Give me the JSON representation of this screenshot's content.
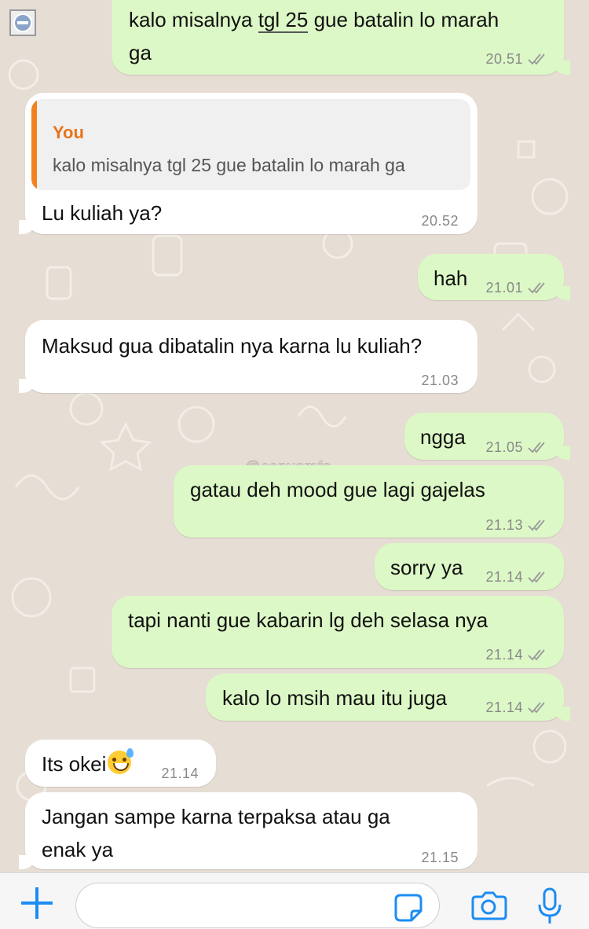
{
  "app": "WhatsApp",
  "colors": {
    "outgoing_bubble": "#dcf8c6",
    "incoming_bubble": "#ffffff",
    "quote_accent": "#f2821f",
    "icon_blue": "#1d8cf3"
  },
  "messages": [
    {
      "dir": "out",
      "lines": [
        "kalo misalnya tgl 25 gue batalin lo marah",
        "ga"
      ],
      "time": "20.51",
      "read_ticks": "double-check-icon"
    },
    {
      "dir": "in",
      "quote": {
        "author": "You",
        "text": "kalo misalnya tgl 25 gue batalin lo marah ga"
      },
      "text": "Lu kuliah ya?",
      "time": "20.52"
    },
    {
      "dir": "out",
      "text": "hah",
      "time": "21.01",
      "read_ticks": "double-check-icon"
    },
    {
      "dir": "in",
      "text": "Maksud gua dibatalin nya karna lu kuliah?",
      "time": "21.03"
    },
    {
      "dir": "out",
      "text": "ngga",
      "time": "21.05",
      "read_ticks": "double-check-icon"
    },
    {
      "dir": "out",
      "text": "gatau deh mood gue lagi gajelas",
      "time": "21.13",
      "read_ticks": "double-check-icon"
    },
    {
      "dir": "out",
      "text": "sorry ya",
      "time": "21.14",
      "read_ticks": "double-check-icon"
    },
    {
      "dir": "out",
      "text": "tapi nanti gue kabarin lg deh selasa nya",
      "time": "21.14",
      "read_ticks": "double-check-icon"
    },
    {
      "dir": "out",
      "text": "kalo lo msih mau itu juga",
      "time": "21.14",
      "read_ticks": "double-check-icon"
    },
    {
      "dir": "in",
      "text": "Its okei",
      "emoji": "grinning-sweat-emoji",
      "time": "21.14"
    },
    {
      "dir": "in",
      "lines": [
        "Jangan sampe karna terpaksa atau ga",
        "enak ya"
      ],
      "time": "21.15"
    }
  ],
  "watermark": "@convomfs",
  "input_bar": {
    "placeholder": "",
    "icons": [
      "plus-icon",
      "sticker-icon",
      "camera-icon",
      "microphone-icon"
    ]
  }
}
